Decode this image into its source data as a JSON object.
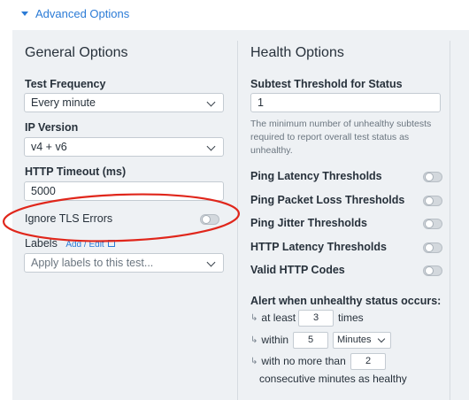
{
  "advanced_options_label": "Advanced Options",
  "general": {
    "title": "General Options",
    "test_frequency": {
      "label": "Test Frequency",
      "value": "Every minute"
    },
    "ip_version": {
      "label": "IP Version",
      "value": "v4 + v6"
    },
    "http_timeout": {
      "label": "HTTP Timeout (ms)",
      "value": "5000"
    },
    "ignore_tls": {
      "label": "Ignore TLS Errors",
      "enabled": false
    },
    "labels": {
      "label": "Labels",
      "link": "Add / Edit",
      "placeholder": "Apply labels to this test..."
    }
  },
  "health": {
    "title": "Health Options",
    "subtest_threshold": {
      "label": "Subtest Threshold for Status",
      "value": "1",
      "help": "The minimum number of unhealthy subtests required to report overall test status as unhealthy."
    },
    "toggles": [
      {
        "label": "Ping Latency Thresholds",
        "enabled": false
      },
      {
        "label": "Ping Packet Loss Thresholds",
        "enabled": false
      },
      {
        "label": "Ping Jitter Thresholds",
        "enabled": false
      },
      {
        "label": "HTTP Latency Thresholds",
        "enabled": false
      },
      {
        "label": "Valid HTTP Codes",
        "enabled": false
      }
    ],
    "alert": {
      "heading": "Alert when unhealthy status occurs:",
      "at_least_label": "at least",
      "at_least_value": "3",
      "times_label": "times",
      "within_label": "within",
      "within_value": "5",
      "within_unit": "Minutes",
      "no_more_than_label": "with no more than",
      "no_more_than_value": "2",
      "consecutive_label": "consecutive minutes as healthy"
    }
  },
  "highlight_color": "#e0261b",
  "accent_color": "#2b7bd6"
}
